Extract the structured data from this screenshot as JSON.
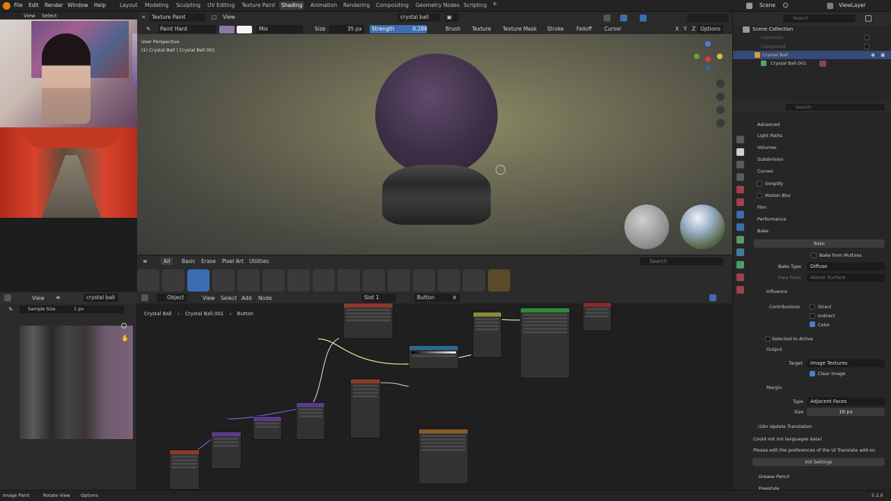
{
  "topbar": {
    "menus": [
      "File",
      "Edit",
      "Render",
      "Window",
      "Help"
    ],
    "workspaces": [
      "Layout",
      "Modeling",
      "Sculpting",
      "UV Editing",
      "Texture Paint",
      "Shading",
      "Animation",
      "Rendering",
      "Compositing",
      "Geometry Nodes",
      "Scripting"
    ],
    "active_workspace": "Shading",
    "add_tab": "+",
    "scene": "Scene",
    "view_layer": "ViewLayer"
  },
  "webcam_header": {
    "view": "View",
    "select": "Select"
  },
  "viewport_header": {
    "mode": "Texture Paint",
    "view": "View",
    "object": "crystal ball",
    "brush_name": "Paint Hard",
    "blend": "Mix",
    "size_label": "Size",
    "size_value": "35 px",
    "strength_label": "Strength",
    "strength_value": "0.288",
    "menus": [
      "Brush",
      "Texture",
      "Texture Mask",
      "Stroke",
      "Falloff",
      "Cursor"
    ],
    "xyz": [
      "X",
      "Y",
      "Z"
    ],
    "options": "Options"
  },
  "viewport": {
    "overlay_line1": "User Perspective",
    "overlay_line2": "(1) Crystal Ball | Crystal Ball.001"
  },
  "brush_asset_bar": {
    "tabs": [
      "All",
      "Basic",
      "Erase",
      "Pixel Art",
      "Utilities"
    ],
    "active_tab": "All",
    "search_placeholder": "Search"
  },
  "image_editor": {
    "view": "View",
    "image_name": "crystal ball",
    "sample_size_label": "Sample Size",
    "sample_size_value": "1 px"
  },
  "node_editor": {
    "object_menu": "Object",
    "menus": [
      "View",
      "Select",
      "Add",
      "Node"
    ],
    "slot": "Slot 1",
    "material": "Button",
    "users": "8",
    "breadcrumb": [
      "Crystal Ball",
      "Crystal Ball.001",
      "Button"
    ]
  },
  "outliner": {
    "title": "Scene Collection",
    "search_placeholder": "Search",
    "items": [
      "Collection",
      "Completed",
      "Crystal Ball",
      "Crystal Ball.001"
    ]
  },
  "properties": {
    "search_placeholder": "Search",
    "sections": [
      "Advanced",
      "Light Paths",
      "Volumes",
      "Subdivision",
      "Curves",
      "Simplify",
      "Motion Blur",
      "Film",
      "Performance",
      "Bake"
    ],
    "bake_button": "Bake",
    "bake_from_multires": "Bake from Multires",
    "bake_type_label": "Bake Type",
    "bake_type_value": "Diffuse",
    "view_from_label": "View From",
    "view_from_value": "Above Surface",
    "influence": "Influence",
    "contributions_label": "Contributions",
    "direct": "Direct",
    "indirect": "Indirect",
    "color": "Color",
    "selected_to_active": "Selected to Active",
    "output": "Output",
    "target_label": "Target",
    "target_value": "Image Textures",
    "clear_image": "Clear Image",
    "margin": "Margin",
    "type_label": "Type",
    "type_value": "Adjacent Faces",
    "size_label": "Size",
    "size_value": "16 px",
    "i18n_header": "I18n Update Translation",
    "i18n_msg1": "Could not init languages data!",
    "i18n_msg2": "Please edit the preferences of the UI Translate add-on",
    "init_settings": "Init Settings",
    "grease_pencil": "Grease Pencil",
    "freestyle": "Freestyle"
  },
  "statusbar": {
    "items": [
      "Image Paint",
      "Rotate View",
      "Options"
    ],
    "version": "5.1.0"
  },
  "colors": {
    "accent_blue": "#4a7fd0",
    "active_workspace_bg": "#3a3a3a",
    "strength_highlight": "#3d6db0"
  },
  "icons": [
    "blender-logo-icon",
    "search-icon",
    "filter-icon",
    "eye-icon",
    "camera-icon",
    "hand-icon",
    "zoom-icon",
    "brush-icon",
    "wrench-icon",
    "material-icon",
    "world-icon",
    "render-icon"
  ]
}
